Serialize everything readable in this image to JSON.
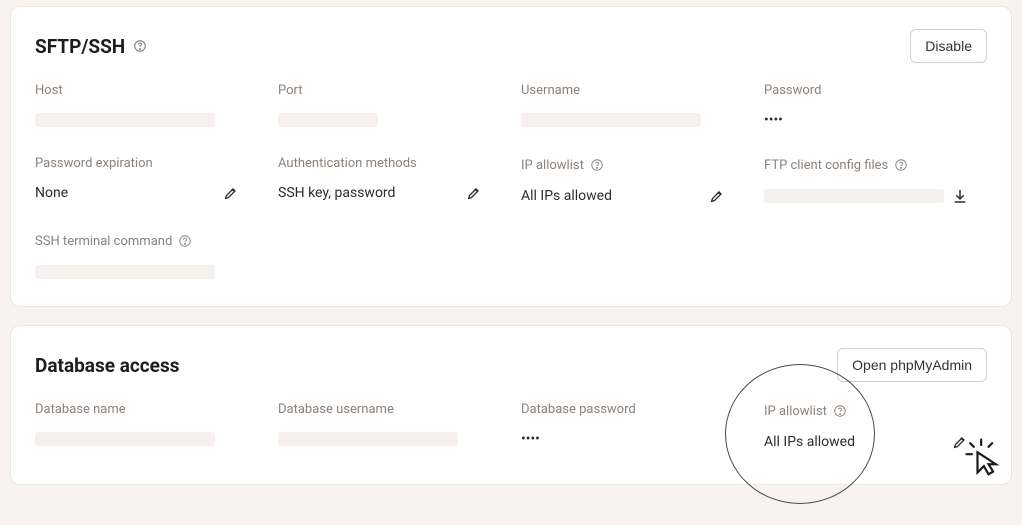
{
  "sftp": {
    "title": "SFTP/SSH",
    "disable": "Disable",
    "fields": {
      "host_label": "Host",
      "port_label": "Port",
      "username_label": "Username",
      "password_label": "Password",
      "password_value": "••••",
      "pw_exp_label": "Password expiration",
      "pw_exp_value": "None",
      "auth_label": "Authentication methods",
      "auth_value": "SSH key, password",
      "allowlist_label": "IP allowlist",
      "allowlist_value": "All IPs allowed",
      "ftp_cfg_label": "FTP client config files",
      "ssh_cmd_label": "SSH terminal command"
    }
  },
  "db": {
    "title": "Database access",
    "open_pma": "Open phpMyAdmin",
    "fields": {
      "name_label": "Database name",
      "user_label": "Database username",
      "pwd_label": "Database password",
      "pwd_value": "••••",
      "allowlist_label": "IP allowlist",
      "allowlist_value": "All IPs allowed"
    }
  }
}
